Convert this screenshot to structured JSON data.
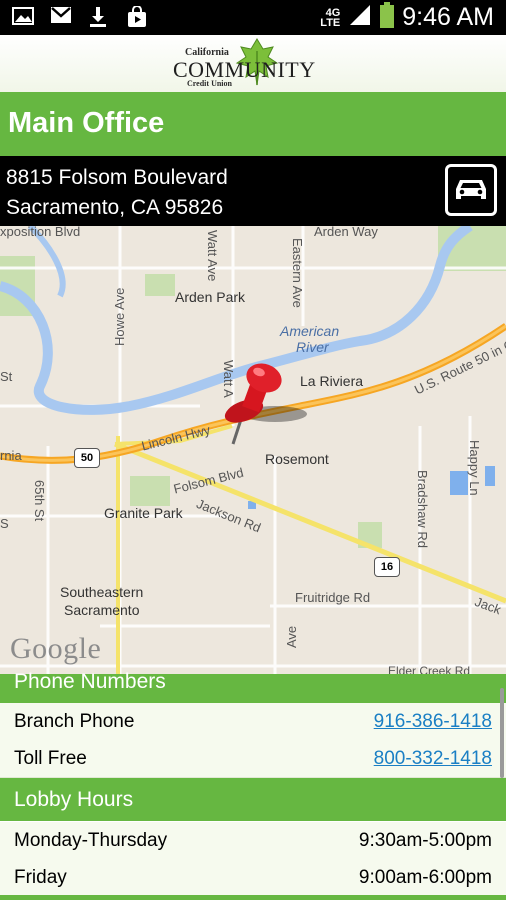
{
  "status_bar": {
    "time": "9:46 AM",
    "network": "4G",
    "network_sub": "LTE",
    "icons": [
      "gallery-icon",
      "gmail-icon",
      "download-icon",
      "shopping-bag-icon",
      "signal-icon",
      "battery-icon"
    ]
  },
  "logo": {
    "line1": "California",
    "line2": "COMMUNITY",
    "line3": "Credit Union"
  },
  "header": {
    "title": "Main Office"
  },
  "address": {
    "line1": "8815 Folsom Boulevard",
    "line2": "Sacramento, CA 95826",
    "directions_icon": "car-icon"
  },
  "map": {
    "labels": {
      "exposition": "xposition Blvd",
      "arden_way": "Arden Way",
      "watt_ave": "Watt Ave",
      "eastern_ave": "Eastern Ave",
      "arden_park": "Arden Park",
      "american_river": "American",
      "american_river2": "River",
      "st_left": "St",
      "howe_ave": "Howe Ave",
      "watt_ave2": "Watt A",
      "la_riviera": "La Riviera",
      "us50": "U.S. Route 50 in C",
      "lincoln_hwy": "Lincoln Hwy",
      "rnia": "rnia",
      "shield_50": "50",
      "rosemont": "Rosemont",
      "folsom_blvd": "Folsom Blvd",
      "happy_ln": "Happy Ln",
      "st_65": "65th St",
      "granite_park": "Granite Park",
      "jackson_rd": "Jackson Rd",
      "bradshaw_rd": "Bradshaw Rd",
      "s_left": "S",
      "shield_16": "16",
      "fruitridge": "Fruitridge Rd",
      "jack": "Jack",
      "se_sac1": "Southeastern",
      "se_sac2": "Sacramento",
      "ave_bottom": "Ave",
      "elder_creek": "Elder Creek Rd",
      "google": "Google"
    },
    "colors": {
      "land": "#ede7dd",
      "water": "#a8c8f0",
      "highway": "#f6a623",
      "road_yellow": "#f5e36a",
      "park": "#c9dfb0"
    }
  },
  "phone_section": {
    "heading": "Phone Numbers",
    "rows": [
      {
        "label": "Branch Phone",
        "value": "916-386-1418"
      },
      {
        "label": "Toll Free",
        "value": "800-332-1418"
      }
    ]
  },
  "hours_section": {
    "heading": "Lobby Hours",
    "rows": [
      {
        "label": "Monday-Thursday",
        "value": "9:30am-5:00pm"
      },
      {
        "label": "Friday",
        "value": "9:00am-6:00pm"
      }
    ]
  },
  "colors": {
    "brand_green": "#66b741",
    "link_blue": "#1a7fc4"
  }
}
